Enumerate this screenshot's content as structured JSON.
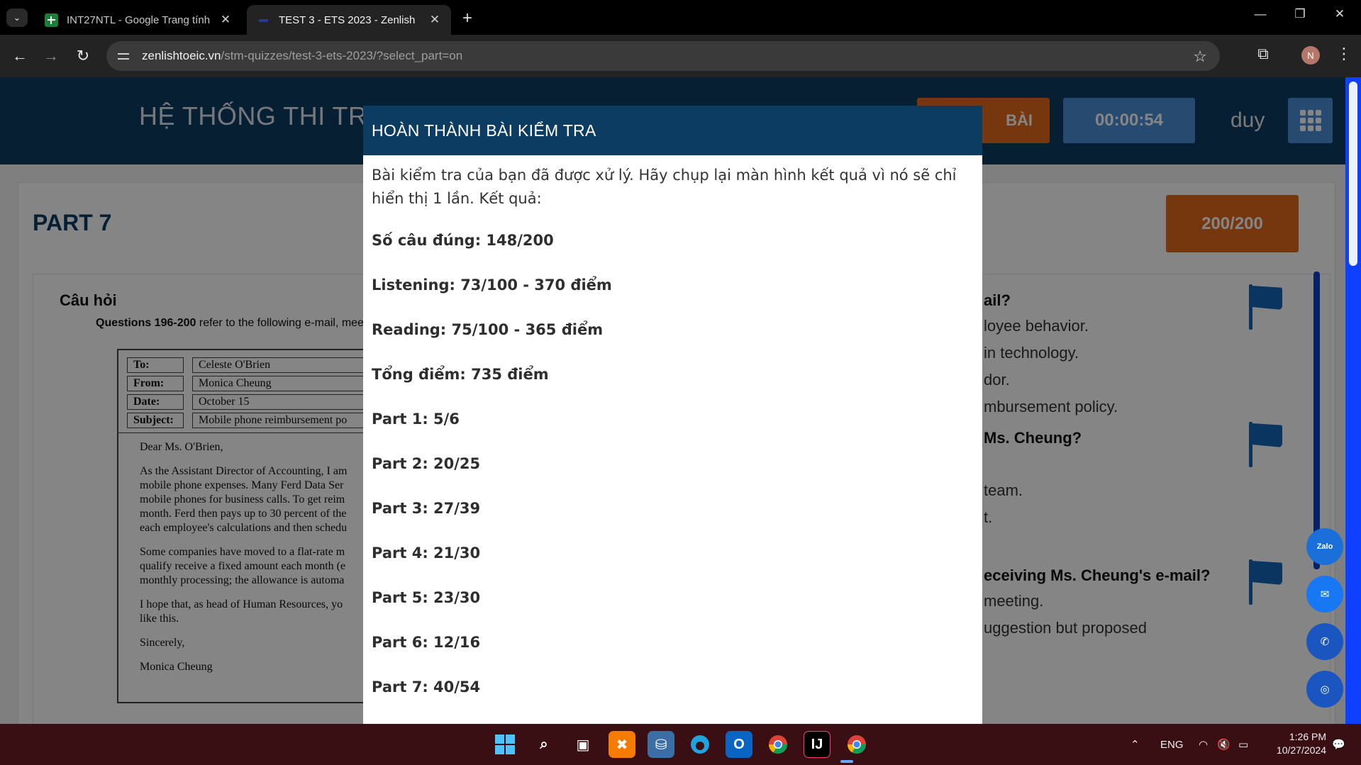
{
  "browser": {
    "tabs": [
      {
        "title": "INT27NTL - Google Trang tính",
        "icon": "google-sheets-icon"
      },
      {
        "title": "TEST 3 - ETS 2023 - Zenlish",
        "icon": "zenlish-icon"
      }
    ],
    "url_host": "zenlishtoeic.vn",
    "url_path": "/stm-quizzes/test-3-ets-2023/?select_part=on",
    "profile_initial": "N"
  },
  "header": {
    "site_title": "HỆ THỐNG THI TRỰC",
    "submit_label": "BÀI",
    "timer": "00:00:54",
    "username": "duy"
  },
  "main": {
    "part_title": "PART 7",
    "score_badge": "200/200",
    "questions_heading": "Câu hỏi",
    "ref_bold": "Questions 196-200",
    "ref_text": "refer to the following e-mail, mee",
    "email": {
      "to_key": "To:",
      "to_val": "Celeste O'Brien",
      "from_key": "From:",
      "from_val": "Monica Cheung",
      "date_key": "Date:",
      "date_val": "October 15",
      "subject_key": "Subject:",
      "subject_val": "Mobile phone reimbursement po",
      "greeting": "Dear Ms. O'Brien,",
      "para1": "As the Assistant Director of Accounting, I am\nmobile phone expenses. Many Ferd Data Ser\nmobile phones for business calls. To get reim\nmonth. Ferd then pays up to 30 percent of the\neach employee's calculations and then schedu",
      "para2": "Some companies have moved to a flat-rate m\nqualify receive a fixed amount each month (e\nmonthly processing; the allowance is automa",
      "para3": "I hope that, as head of Human Resources, yo\nlike this.",
      "closing": "Sincerely,",
      "signature": "Monica Cheung"
    },
    "right_column": {
      "q1": "ail?",
      "q1_opts": [
        "loyee behavior.",
        "in technology.",
        "dor.",
        "mbursement policy."
      ],
      "q2": "Ms. Cheung?",
      "q2_opts": [
        "team.",
        "t."
      ],
      "q3": "eceiving Ms. Cheung's e-mail?",
      "q3_opts": [
        "meeting.",
        "uggestion but proposed"
      ]
    }
  },
  "modal": {
    "title": "HOÀN THÀNH BÀI KIỂM TRA",
    "intro": "Bài kiểm tra của bạn đã được xử lý. Hãy chụp lại màn hình kết quả vì nó sẽ chỉ hiển thị 1 lần. Kết quả:",
    "correct": "Số câu đúng: 148/200",
    "listening": "Listening: 73/100 - 370 điểm",
    "reading": "Reading: 75/100 - 365 điểm",
    "total": "Tổng điểm: 735 điểm",
    "parts": [
      "Part 1: 5/6",
      "Part 2: 20/25",
      "Part 3: 27/39",
      "Part 4: 21/30",
      "Part 5: 23/30",
      "Part 6: 12/16",
      "Part 7: 40/54"
    ]
  },
  "social": {
    "zalo_label": "Zalo"
  },
  "taskbar": {
    "language": "ENG",
    "time": "1:26 PM",
    "date": "10/27/2024"
  }
}
